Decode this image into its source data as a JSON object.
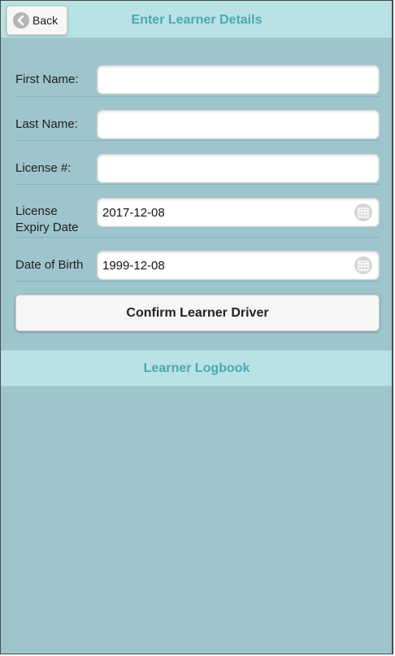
{
  "header": {
    "back_label": "Back",
    "title": "Enter Learner Details"
  },
  "form": {
    "first_name": {
      "label": "First Name:",
      "value": ""
    },
    "last_name": {
      "label": "Last Name:",
      "value": ""
    },
    "license_number": {
      "label": "License #:",
      "value": ""
    },
    "license_expiry": {
      "label_line1": "License",
      "label_line2": "Expiry Date",
      "value": "2017-12-08"
    },
    "date_of_birth": {
      "label": "Date of Birth",
      "value": "1999-12-08"
    },
    "confirm_label": "Confirm Learner Driver"
  },
  "footer": {
    "title": "Learner Logbook"
  },
  "icons": {
    "back": "chevron-left-icon",
    "calendar": "calendar-icon"
  },
  "colors": {
    "page_background": "#9fc5cc",
    "bar_background": "#b9e2e4",
    "title_accent": "#4aa8b2",
    "button_background": "#f6f6f6"
  }
}
